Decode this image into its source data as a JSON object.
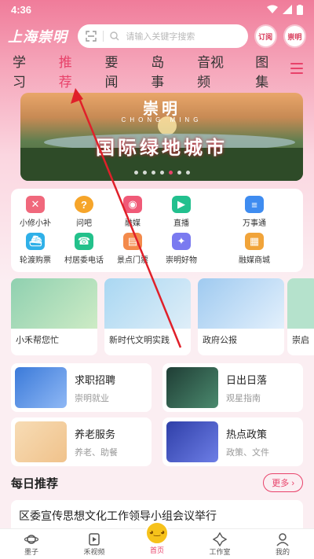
{
  "status": {
    "time": "4:36"
  },
  "header": {
    "logo": "上海崇明",
    "search_placeholder": "请输入关键字搜索",
    "btn1": "订阅",
    "btn2": "崇明"
  },
  "tabs": [
    "学习",
    "推荐",
    "要闻",
    "岛事",
    "音视频",
    "图集"
  ],
  "active_tab": "推荐",
  "banner": {
    "title": "崇明",
    "subtitle": "CHONG MING",
    "slogan": "国际绿地城市"
  },
  "services": [
    {
      "label": "小修小补",
      "icon": "tools-icon",
      "color": "#f0687c",
      "glyph": "✕"
    },
    {
      "label": "问吧",
      "icon": "question-icon",
      "color": "#f6a52a",
      "glyph": "?"
    },
    {
      "label": "融媒",
      "icon": "camera-icon",
      "color": "#f05a78",
      "glyph": "◉"
    },
    {
      "label": "直播",
      "icon": "play-icon",
      "color": "#22c08e",
      "glyph": "▶"
    },
    {
      "label": "万事通",
      "icon": "document-icon",
      "color": "#3f8cf0",
      "glyph": "≡"
    },
    {
      "label": "轮渡购票",
      "icon": "ferry-icon",
      "color": "#2fb0e8",
      "glyph": "⛴"
    },
    {
      "label": "村居委电话",
      "icon": "phone-icon",
      "color": "#23c18b",
      "glyph": "☎"
    },
    {
      "label": "景点门票",
      "icon": "ticket-icon",
      "color": "#f38a4b",
      "glyph": "▤"
    },
    {
      "label": "崇明好物",
      "icon": "gift-icon",
      "color": "#7a7af0",
      "glyph": "✦"
    },
    {
      "label": "融媒商城",
      "icon": "shop-icon",
      "color": "#f1a43a",
      "glyph": "▦"
    }
  ],
  "features": [
    {
      "label": "小禾帮您忙",
      "color": "#8fd0b0"
    },
    {
      "label": "新时代文明实践",
      "color": "#a9d7f2"
    },
    {
      "label": "政府公报",
      "color": "#cfe6fb"
    },
    {
      "label": "崇启",
      "color": "#b5e2cc"
    }
  ],
  "cards": [
    {
      "title": "求职招聘",
      "sub": "崇明就业",
      "color": "#3b7ad9"
    },
    {
      "title": "日出日落",
      "sub": "观星指南",
      "color": "#2f5a4a"
    },
    {
      "title": "养老服务",
      "sub": "养老、助餐",
      "color": "#f0c28b"
    },
    {
      "title": "热点政策",
      "sub": "政策、文件",
      "color": "#2f3fa8"
    }
  ],
  "daily": {
    "title": "每日推荐",
    "more": "更多 ›"
  },
  "article": {
    "title": "区委宣传思想文化工作领导小组会议举行"
  },
  "nav": [
    {
      "label": "墨子",
      "icon": "planet-icon"
    },
    {
      "label": "禾视频",
      "icon": "video-icon"
    },
    {
      "label": "首页",
      "icon": "home-mascot-icon"
    },
    {
      "label": "工作室",
      "icon": "studio-icon"
    },
    {
      "label": "我的",
      "icon": "user-icon"
    }
  ]
}
